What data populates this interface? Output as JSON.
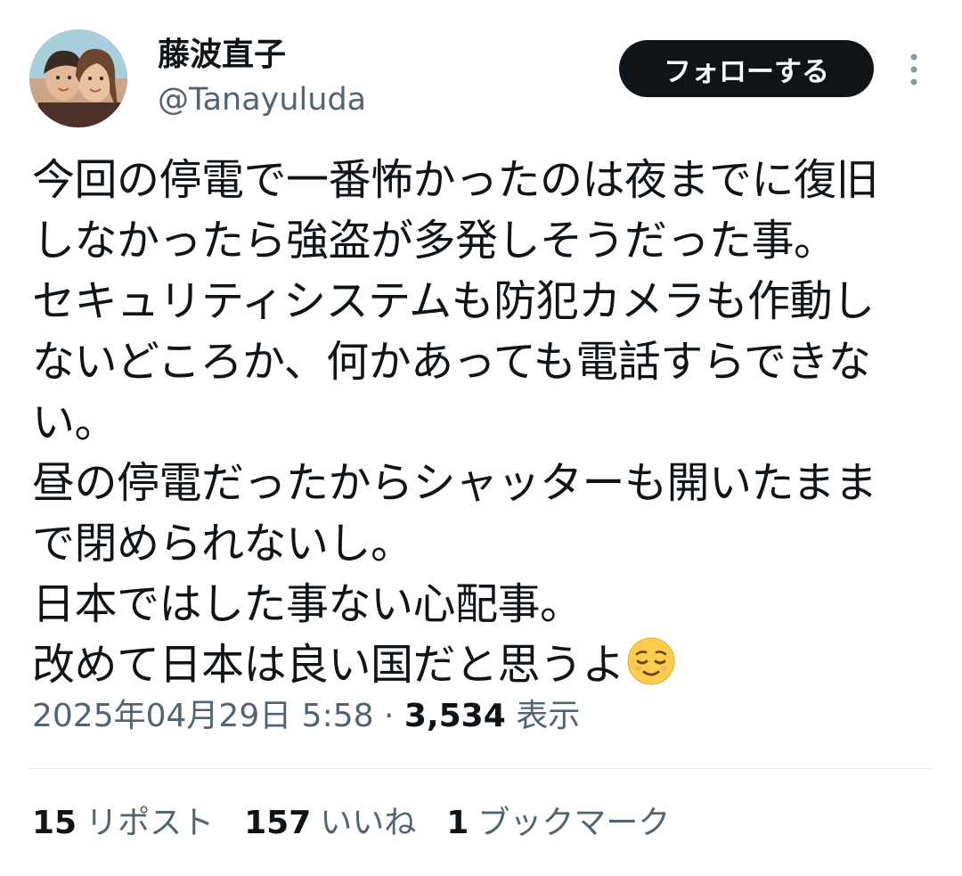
{
  "author": {
    "display_name": "藤波直子",
    "handle": "@Tanayuluda",
    "avatar_icon": "profile-photo"
  },
  "actions": {
    "follow_label": "フォローする",
    "more_icon": "more-vertical-icon"
  },
  "tweet": {
    "lines": [
      "今回の停電で一番怖かったのは夜までに復旧",
      "しなかったら強盗が多発しそうだった事。",
      "セキュリティシステムも防犯カメラも作動し",
      "ないどころか、何かあっても電話すらできな",
      "い。",
      "昼の停電だったからシャッターも開いたまま",
      "で閉められないし。",
      "日本ではした事ない心配事。",
      "改めて日本は良い国だと思うよ"
    ],
    "emoji": "relieved-face"
  },
  "meta": {
    "timestamp": "2025年04月29日 5:58",
    "separator": "·",
    "views_count": "3,534",
    "views_label": "表示"
  },
  "stats": {
    "reposts_count": "15",
    "reposts_label": "リポスト",
    "likes_count": "157",
    "likes_label": "いいね",
    "bookmarks_count": "1",
    "bookmarks_label": "ブックマーク"
  },
  "colors": {
    "text_primary": "#0f1419",
    "text_secondary": "#536471",
    "button_bg": "#0f1419",
    "divider": "#e6e9ec"
  }
}
